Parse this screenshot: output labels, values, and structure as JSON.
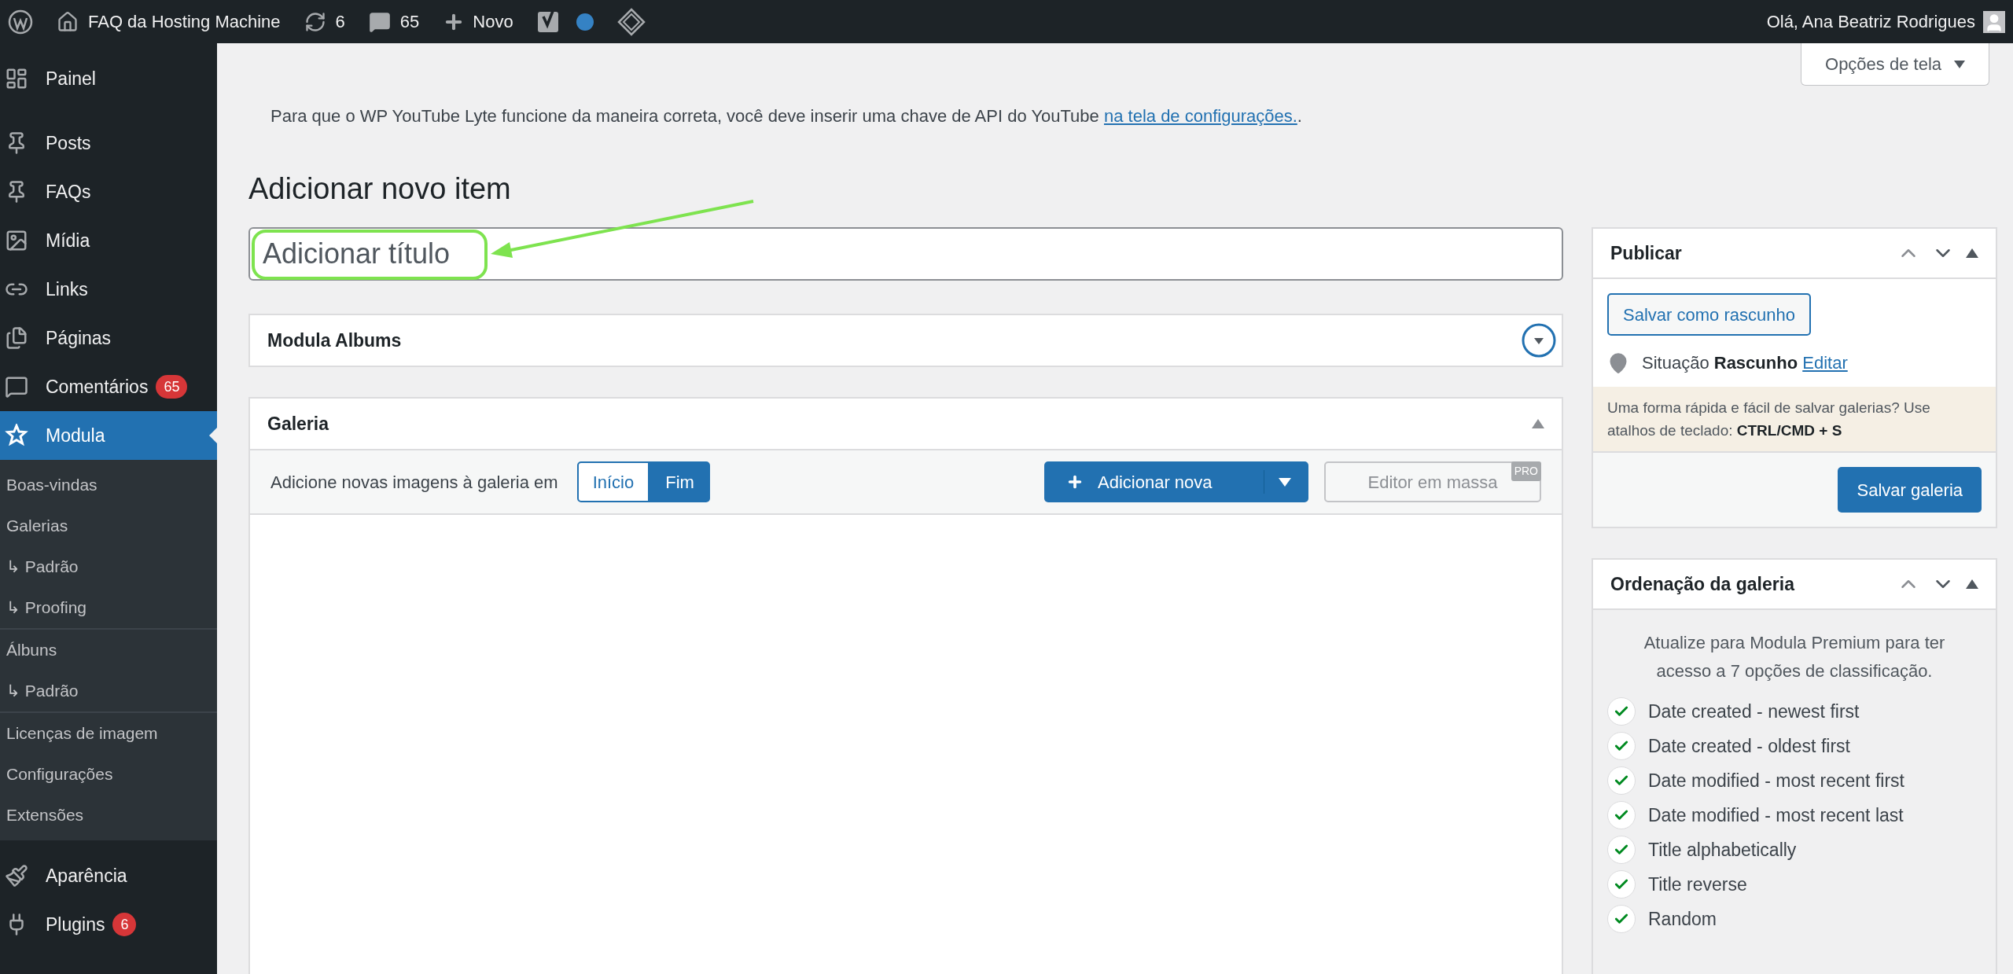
{
  "admin_bar": {
    "site_name": "FAQ da Hosting Machine",
    "updates": "6",
    "comments": "65",
    "new": "Novo",
    "greeting": "Olá, Ana Beatriz Rodrigues"
  },
  "sidebar": {
    "items": [
      {
        "label": "Painel",
        "selected": false
      },
      {
        "label": "Posts",
        "selected": false
      },
      {
        "label": "FAQs",
        "selected": false
      },
      {
        "label": "Mídia",
        "selected": false
      },
      {
        "label": "Links",
        "selected": false
      },
      {
        "label": "Páginas",
        "selected": false
      },
      {
        "label": "Comentários",
        "badge": "65",
        "selected": false
      },
      {
        "label": "Modula",
        "selected": true,
        "submenu_groups": [
          [
            {
              "label": "Boas-vindas",
              "selected": false
            },
            {
              "label": "Galerias",
              "selected": false
            },
            {
              "label": "↳ Padrão",
              "selected": false
            },
            {
              "label": "↳ Proofing",
              "selected": false
            }
          ],
          [
            {
              "label": "Álbuns",
              "selected": false
            },
            {
              "label": "↳ Padrão",
              "selected": false
            }
          ],
          [
            {
              "label": "Licenças de imagem",
              "selected": false
            },
            {
              "label": "Configurações",
              "selected": false
            },
            {
              "label": "Extensões",
              "selected": false
            }
          ]
        ]
      },
      {
        "label": "Aparência",
        "selected": false
      },
      {
        "label": "Plugins",
        "badge": "6",
        "selected": false
      }
    ]
  },
  "screen_options": "Opções de tela",
  "notice": {
    "text": "Para que o WP YouTube Lyte funcione da maneira correta, você deve inserir uma chave de API do YouTube",
    "link": "na tela de configurações.",
    "suffix": "."
  },
  "heading": "Adicionar novo item",
  "title_field": {
    "placeholder": "Adicionar título"
  },
  "albums_box": {
    "title": "Modula Albums"
  },
  "gallery_box": {
    "title": "Galeria",
    "toolbar_label": "Adicione novas imagens à galeria em",
    "position_toggle": [
      {
        "label": "Início",
        "selected": false
      },
      {
        "label": "Fim",
        "selected": true
      }
    ],
    "add_button": "Adicionar nova",
    "bulk_editor": "Editor em massa",
    "pro_badge": "PRO"
  },
  "publish_box": {
    "title": "Publicar",
    "draft_button": "Salvar como rascunho",
    "status_label": "Situação",
    "status_value": "Rascunho",
    "edit_link": "Editar",
    "tip": "Uma forma rápida e fácil de salvar galerias? Use atalhos de teclado: **CTRL/CMD + S**",
    "save_button": "Salvar galeria"
  },
  "sorting_box": {
    "title": "Ordenação da galeria",
    "upgrade_text": "Atualize para Modula Premium para ter acesso a 7 opções de classificação.",
    "options": [
      {
        "label": "Date created - newest first",
        "checked": true
      },
      {
        "label": "Date created - oldest first",
        "checked": true
      },
      {
        "label": "Date modified - most recent first",
        "checked": true
      },
      {
        "label": "Date modified - most recent last",
        "checked": true
      },
      {
        "label": "Title alphabetically",
        "checked": true
      },
      {
        "label": "Title reverse",
        "checked": true
      },
      {
        "label": "Random",
        "checked": true
      }
    ]
  }
}
